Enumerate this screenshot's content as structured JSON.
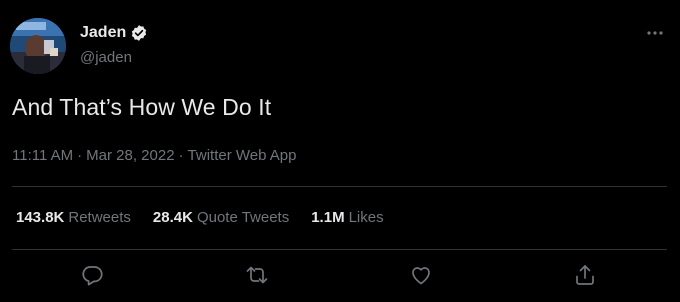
{
  "colors": {
    "background": "#000000",
    "text_primary": "#e7e9ea",
    "text_secondary": "#71767b",
    "divider": "#2f3336"
  },
  "author": {
    "display_name": "Jaden",
    "handle": "@jaden",
    "verified": true,
    "avatar_icon": "profile-photo"
  },
  "tweet": {
    "text": "And That’s How We Do It"
  },
  "meta": {
    "time": "11:11 AM",
    "sep1": "·",
    "date": "Mar 28, 2022",
    "sep2": "·",
    "source": "Twitter Web App"
  },
  "stats": {
    "retweets_value": "143.8K",
    "retweets_label": "Retweets",
    "quotes_value": "28.4K",
    "quotes_label": "Quote Tweets",
    "likes_value": "1.1M",
    "likes_label": "Likes"
  },
  "actions": {
    "reply_icon": "reply-icon",
    "retweet_icon": "retweet-icon",
    "like_icon": "heart-icon",
    "share_icon": "share-icon",
    "more_icon": "more-dots-icon"
  }
}
